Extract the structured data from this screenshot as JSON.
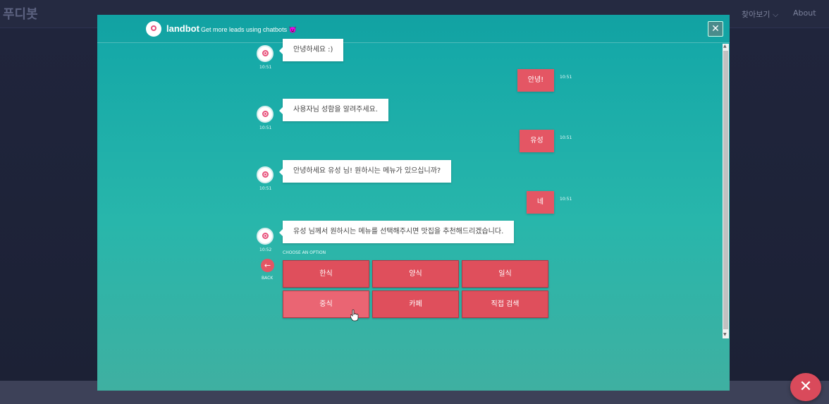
{
  "page": {
    "logo": "푸디봇",
    "nav": {
      "explore": "찾아보기 ⌵",
      "about": "About"
    },
    "fab_close": "✕"
  },
  "modal": {
    "brand": "landbot",
    "tagline": "Get more leads using chatbots 😈",
    "close_icon": "✕"
  },
  "chat": {
    "messages": [
      {
        "from": "bot",
        "text": "안녕하세요 :)",
        "time": "10:51"
      },
      {
        "from": "user",
        "text": "안녕!",
        "time": "10:51"
      },
      {
        "from": "bot",
        "text": "사용자님 성함을 알려주세요.",
        "time": "10:51"
      },
      {
        "from": "user",
        "text": "유성",
        "time": "10:51"
      },
      {
        "from": "bot",
        "text": "안녕하세요 유성 님! 원하시는 메뉴가 있으십니까?",
        "time": "10:51"
      },
      {
        "from": "user",
        "text": "네",
        "time": "10:51"
      },
      {
        "from": "bot",
        "text": "유성 님께서 원하시는 메뉴를 선택해주시면 맛집을 추천해드리겠습니다.",
        "time": "10:52"
      }
    ],
    "choose_label": "CHOOSE AN OPTION",
    "back_label": "BACK",
    "back_icon": "←",
    "options": [
      "한식",
      "양식",
      "일식",
      "중식",
      "카페",
      "직접 검색"
    ]
  },
  "colors": {
    "accent": "#e45664",
    "teal_top": "#12a6a7",
    "teal_bottom": "#3fb0a1"
  }
}
